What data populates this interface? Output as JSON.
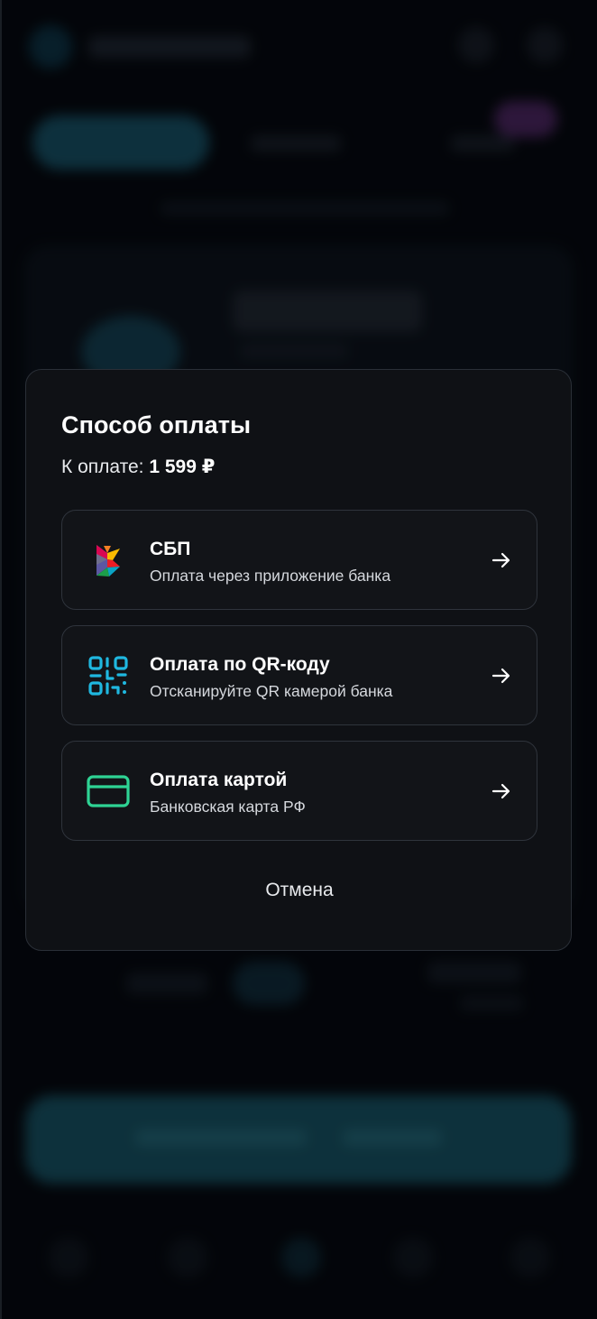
{
  "sheet": {
    "title": "Способ оплаты",
    "amount_label": "К оплате:",
    "amount_value": "1 599 ₽",
    "options": [
      {
        "title": "СБП",
        "subtitle": "Оплата через приложение банка",
        "icon": "sbp-logo-icon"
      },
      {
        "title": "Оплата по QR-коду",
        "subtitle": "Отсканируйте QR камерой банка",
        "icon": "qr-code-icon"
      },
      {
        "title": "Оплата картой",
        "subtitle": "Банковская карта РФ",
        "icon": "bank-card-icon"
      }
    ],
    "cancel_label": "Отмена"
  },
  "colors": {
    "sheet_background": "#0f1115",
    "option_border": "#2f343c",
    "qr_icon": "#1fb8e0",
    "card_icon": "#2ed394",
    "arrow": "#ffffff"
  }
}
